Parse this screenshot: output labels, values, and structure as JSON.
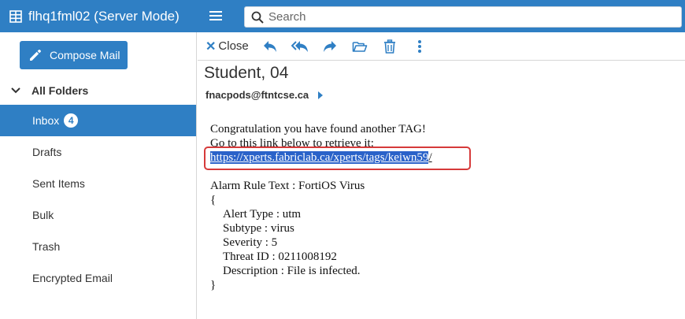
{
  "app": {
    "title": "flhq1fml02 (Server Mode)"
  },
  "search": {
    "placeholder": "Search"
  },
  "sidebar": {
    "compose_label": "Compose Mail",
    "folders_heading": "All Folders",
    "folders": [
      {
        "label": "Inbox",
        "badge": "4",
        "active": true
      },
      {
        "label": "Drafts"
      },
      {
        "label": "Sent Items"
      },
      {
        "label": "Bulk"
      },
      {
        "label": "Trash"
      },
      {
        "label": "Encrypted Email"
      }
    ]
  },
  "toolbar": {
    "close_label": "Close",
    "icons": [
      "reply-icon",
      "reply-all-icon",
      "forward-icon",
      "move-to-folder-icon",
      "delete-icon",
      "more-options-icon"
    ]
  },
  "message": {
    "subject": "Student, 04",
    "from": "fnacpods@ftntcse.ca",
    "body": {
      "line1": "Congratulation you have found another TAG!",
      "line2": "Go to this link below to retrieve it:",
      "link_selected": "https://xperts.fabriclab.ca/xperts/tags/keiwn59",
      "link_tail": "/",
      "rule_title": "Alarm Rule Text : FortiOS Virus",
      "open_brace": "{",
      "alert_type": "Alert Type : utm",
      "subtype": "Subtype : virus",
      "severity": "Severity : 5",
      "threat_id": "Threat ID : 0211008192",
      "description": "Description : File is infected.",
      "close_brace": "}"
    }
  },
  "colors": {
    "accent": "#2f7fc4",
    "selection": "#2a62c9",
    "highlight_border": "#d63a3a"
  }
}
